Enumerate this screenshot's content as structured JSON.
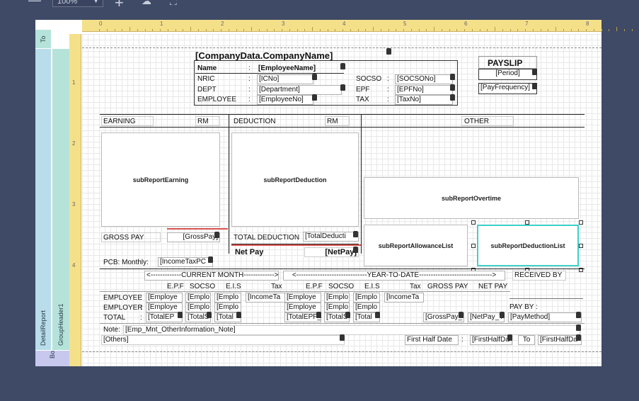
{
  "toolbar": {
    "zoom_value": "100%"
  },
  "ruler": {
    "top_ticks": [
      "0",
      "1",
      "2",
      "3",
      "4",
      "5",
      "6",
      "7",
      "8"
    ],
    "left_ticks": [
      "1",
      "2",
      "3",
      "4"
    ]
  },
  "bands": {
    "top_label": "To",
    "detail_label": "DetailReport",
    "group_label": "GroupHeader1",
    "bottom_label": "Bo"
  },
  "header": {
    "company": "[CompanyData.CompanyName]",
    "payslip_title": "PAYSLIP",
    "period": "[Period]",
    "pay_frequency": "[PayFrequency]",
    "name_label": "Name",
    "name_value": "[EmployeeName]",
    "nric_label": "NRIC",
    "nric_value": "[ICNo]",
    "dept_label": "DEPT",
    "dept_value": "[Department]",
    "employee_label": "EMPLOYEE",
    "employee_value": "[EmployeeNo]",
    "socso_label": "SOCSO",
    "socso_value": "[SOCSONo]",
    "epf_label": "EPF",
    "epf_value": "[EPFNo]",
    "tax_label": "TAX",
    "tax_value": "[TaxNo]",
    "colon": ":"
  },
  "sections": {
    "earning": "EARNING",
    "rm1": "RM",
    "deduction": "DEDUCTION",
    "rm2": "RM",
    "other": "OTHER"
  },
  "subreports": {
    "earning": "subReportEarning",
    "deduction": "subReportDeduction",
    "overtime": "subReportOvertime",
    "allowance": "subReportAllowanceList",
    "deduction_list": "subReportDeductionList"
  },
  "totals": {
    "gross_pay_label": "GROSS PAY",
    "gross_pay_value": "[GrossPay]",
    "total_deduction_label": "TOTAL DEDUCTION",
    "total_deduction_value": "[TotalDeducti",
    "net_pay_label": "Net Pay",
    "net_pay_value": "[NetPay]",
    "pcb_label": "PCB: Monthly:",
    "pcb_value": "[IncomeTaxPC"
  },
  "contrib": {
    "current_month": "<-------------CURRENT MONTH------------->",
    "year_to_date": "<------------------------------YEAR-TO-DATE------------------------------->",
    "received_by": "RECEIVED BY",
    "col_epf": "E.P.F",
    "col_socso": "SOCSO",
    "col_eis": "E.I.S",
    "col_tax": "Tax",
    "col_epf2": "E.P.F",
    "col_socso2": "SOCSO",
    "col_eis2": "E.I.S",
    "col_tax2": "Tax",
    "col_gross": "GROSS PAY",
    "col_net": "NET PAY",
    "row_employee": "EMPLOYEE",
    "row_employer": "EMPLOYER",
    "row_total": "TOTAL",
    "emp_epf": "[Employe",
    "emp_socso": "[Emplo",
    "emp_eis": "[Emplo",
    "emp_tax": "[IncomeTa",
    "emp_epf2": "[Employe",
    "emp_socso2": "[Emplo",
    "emp_eis2": "[Emplo",
    "emp_tax2": "[IncomeTa",
    "er_epf": "[Employe",
    "er_socso": "[Emplo",
    "er_eis": "[Emplo",
    "er_epf2": "[Employe",
    "er_socso2": "[Emplo",
    "er_eis2": "[Emplo",
    "tot_epf": "[TotalEP",
    "tot_socso": "[TotalS",
    "tot_eis": "[Total",
    "tot_epf2": "[TotalEPF_",
    "tot_socso2": "[TotalS",
    "tot_eis2": "[Total",
    "tot_gross": "[GrossPay_",
    "tot_net": "[NetPay_Y",
    "pay_by_label": "PAY BY :",
    "pay_method": "[PayMethod]"
  },
  "notes": {
    "note_label": "Note:",
    "note_value": "[Emp_Mnt_OtherInformation_Note]",
    "others_value": "[Others]",
    "first_half_label": "First Half Date",
    "first_half_value1": "[FirstHalfDa",
    "to_label": "To",
    "first_half_value2": "[FirstHalfDa"
  }
}
